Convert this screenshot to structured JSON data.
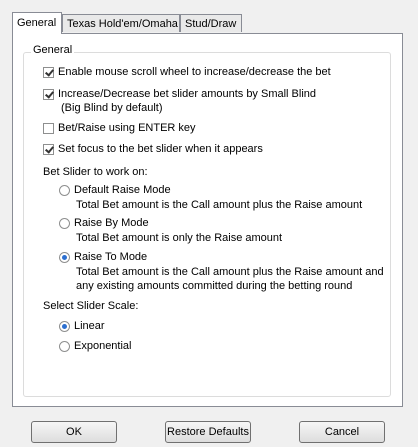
{
  "tabs": [
    {
      "label": "General",
      "active": true
    },
    {
      "label": "Texas Hold'em/Omaha",
      "active": false
    },
    {
      "label": "Stud/Draw",
      "active": false
    }
  ],
  "group": {
    "title": "General",
    "checkboxes": [
      {
        "label": "Enable mouse scroll wheel to increase/decrease the bet",
        "checked": true
      },
      {
        "label": "Increase/Decrease bet slider amounts by Small Blind",
        "sublabel": "(Big Blind by default)",
        "checked": true
      },
      {
        "label": "Bet/Raise using ENTER key",
        "checked": false
      },
      {
        "label": "Set focus to the bet slider when it appears",
        "checked": true
      }
    ],
    "slider_section": {
      "title": "Bet Slider to work on:",
      "options": [
        {
          "label": "Default Raise Mode",
          "desc": [
            "Total Bet amount is the Call amount plus the Raise amount"
          ],
          "checked": false
        },
        {
          "label": "Raise By Mode",
          "desc": [
            "Total Bet amount is only the Raise amount"
          ],
          "checked": false
        },
        {
          "label": "Raise To Mode",
          "desc": [
            "Total Bet amount is the Call amount plus the Raise amount and",
            "any existing amounts committed during the betting round"
          ],
          "checked": true
        }
      ]
    },
    "scale_section": {
      "title": "Select Slider Scale:",
      "options": [
        {
          "label": "Linear",
          "checked": true
        },
        {
          "label": "Exponential",
          "checked": false
        }
      ]
    }
  },
  "buttons": {
    "ok": "OK",
    "restore": "Restore Defaults",
    "cancel": "Cancel"
  }
}
